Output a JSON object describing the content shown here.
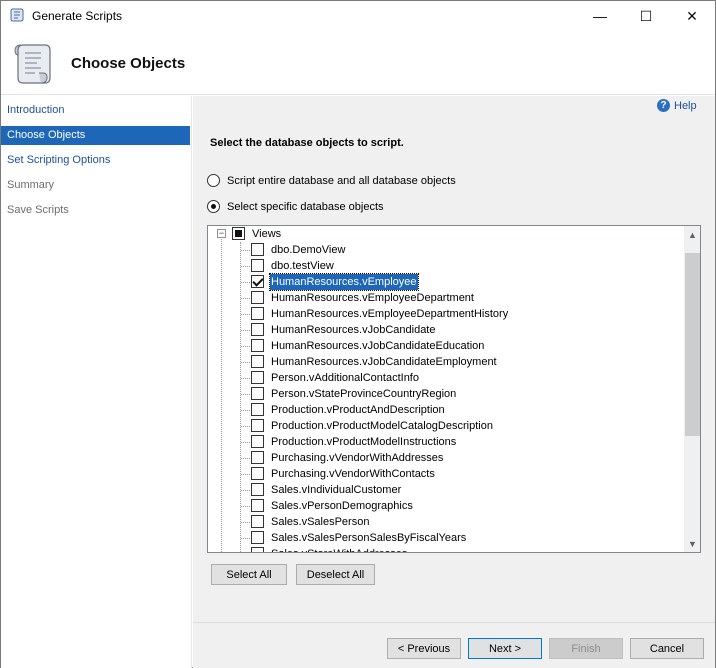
{
  "window": {
    "title": "Generate Scripts",
    "icon": "scroll-icon",
    "controls": {
      "minimize": "—",
      "maximize": "☐",
      "close": "✕"
    }
  },
  "header": {
    "title": "Choose Objects",
    "icon": "script-scroll-icon"
  },
  "nav": {
    "items": [
      {
        "label": "Introduction",
        "state": "link"
      },
      {
        "label": "Choose Objects",
        "state": "selected"
      },
      {
        "label": "Set Scripting Options",
        "state": "link"
      },
      {
        "label": "Summary",
        "state": "disabled"
      },
      {
        "label": "Save Scripts",
        "state": "disabled"
      }
    ]
  },
  "main": {
    "help_label": "Help",
    "heading": "Select the database objects to script.",
    "radio_entire": "Script entire database and all database objects",
    "radio_specific": "Select specific database objects",
    "selected_radio": "specific",
    "tree": {
      "root_label": "Views",
      "root_state": "partial",
      "items": [
        {
          "label": "dbo.DemoView",
          "checked": false,
          "selected": false
        },
        {
          "label": "dbo.testView",
          "checked": false,
          "selected": false
        },
        {
          "label": "HumanResources.vEmployee",
          "checked": true,
          "selected": true
        },
        {
          "label": "HumanResources.vEmployeeDepartment",
          "checked": false,
          "selected": false
        },
        {
          "label": "HumanResources.vEmployeeDepartmentHistory",
          "checked": false,
          "selected": false
        },
        {
          "label": "HumanResources.vJobCandidate",
          "checked": false,
          "selected": false
        },
        {
          "label": "HumanResources.vJobCandidateEducation",
          "checked": false,
          "selected": false
        },
        {
          "label": "HumanResources.vJobCandidateEmployment",
          "checked": false,
          "selected": false
        },
        {
          "label": "Person.vAdditionalContactInfo",
          "checked": false,
          "selected": false
        },
        {
          "label": "Person.vStateProvinceCountryRegion",
          "checked": false,
          "selected": false
        },
        {
          "label": "Production.vProductAndDescription",
          "checked": false,
          "selected": false
        },
        {
          "label": "Production.vProductModelCatalogDescription",
          "checked": false,
          "selected": false
        },
        {
          "label": "Production.vProductModelInstructions",
          "checked": false,
          "selected": false
        },
        {
          "label": "Purchasing.vVendorWithAddresses",
          "checked": false,
          "selected": false
        },
        {
          "label": "Purchasing.vVendorWithContacts",
          "checked": false,
          "selected": false
        },
        {
          "label": "Sales.vIndividualCustomer",
          "checked": false,
          "selected": false
        },
        {
          "label": "Sales.vPersonDemographics",
          "checked": false,
          "selected": false
        },
        {
          "label": "Sales.vSalesPerson",
          "checked": false,
          "selected": false
        },
        {
          "label": "Sales.vSalesPersonSalesByFiscalYears",
          "checked": false,
          "selected": false
        },
        {
          "label": "Sales.vStoreWithAddresses",
          "checked": false,
          "selected": false
        }
      ]
    },
    "select_all": "Select All",
    "deselect_all": "Deselect All"
  },
  "footer": {
    "previous": "< Previous",
    "next": "Next >",
    "finish": "Finish",
    "cancel": "Cancel"
  },
  "colors": {
    "accent": "#1d66b8",
    "link": "#1c4f9c",
    "panel": "#f0f0f0"
  }
}
